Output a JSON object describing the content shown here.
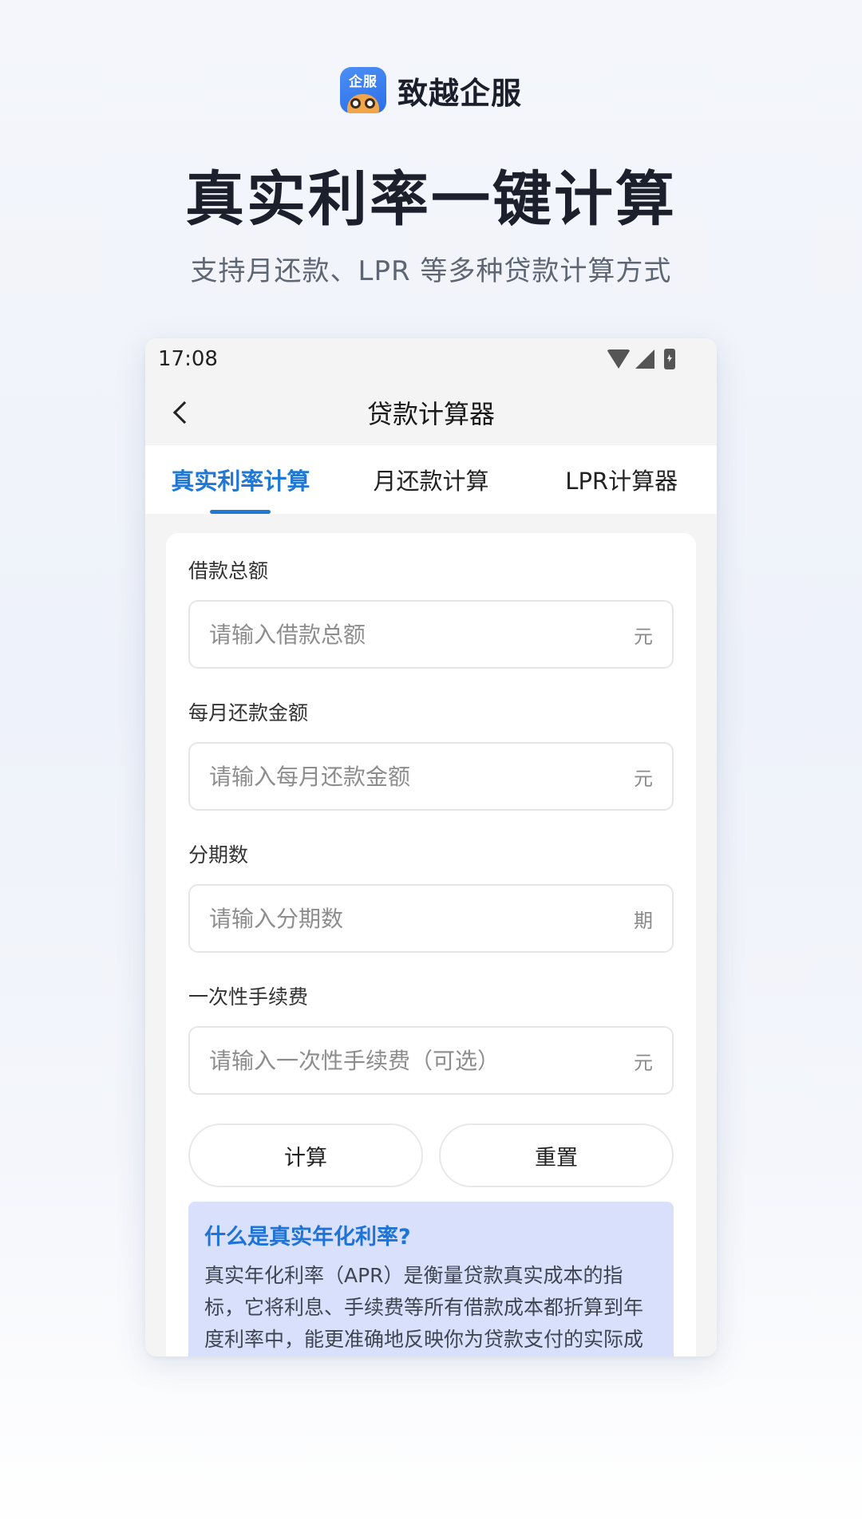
{
  "brand": {
    "logo_text": "企服",
    "name": "致越企服"
  },
  "hero": {
    "title": "真实利率一键计算",
    "subtitle": "支持月还款、LPR 等多种贷款计算方式"
  },
  "status_bar": {
    "time": "17:08"
  },
  "app_bar": {
    "title": "贷款计算器"
  },
  "tabs": [
    {
      "label": "真实利率计算",
      "active": true
    },
    {
      "label": "月还款计算",
      "active": false
    },
    {
      "label": "LPR计算器",
      "active": false
    }
  ],
  "form": {
    "fields": [
      {
        "label": "借款总额",
        "placeholder": "请输入借款总额",
        "unit": "元"
      },
      {
        "label": "每月还款金额",
        "placeholder": "请输入每月还款金额",
        "unit": "元"
      },
      {
        "label": "分期数",
        "placeholder": "请输入分期数",
        "unit": "期"
      },
      {
        "label": "一次性手续费",
        "placeholder": "请输入一次性手续费（可选）",
        "unit": "元"
      }
    ],
    "calculate_label": "计算",
    "reset_label": "重置"
  },
  "info": {
    "title": "什么是真实年化利率?",
    "text": "真实年化利率（APR）是衡量贷款真实成本的指标，它将利息、手续费等所有借款成本都折算到年度利率中，能更准确地反映你为贷款支付的实际成本。"
  },
  "colors": {
    "accent": "#1f77d6",
    "info_bg": "#d9e0fb"
  }
}
